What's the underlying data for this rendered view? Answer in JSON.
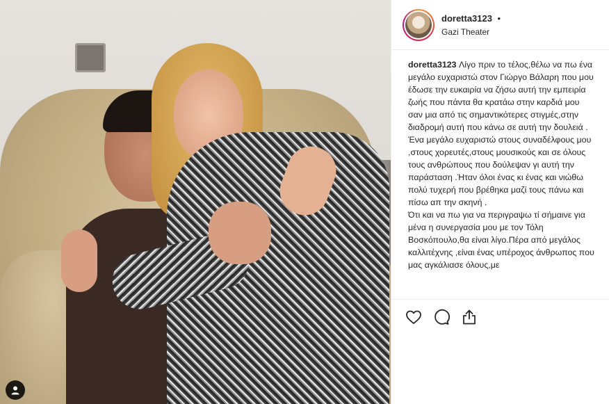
{
  "post": {
    "username": "doretta3123",
    "dot": "•",
    "location": "Gazi Theater"
  },
  "caption": {
    "username": "doretta3123",
    "text": " Λίγο πριν το τέλος,θέλω να πω ένα μεγάλο ευχαριστώ στον Γιώργο Βάλαρη που μου έδωσε την ευκαιρία να ζήσω αυτή την εμπειρία ζωής που πάντα θα κρατάω στην καρδιά μου σαν μια από τις σημαντικότερες στιγμές,στην διαδρομή αυτή που κάνω σε αυτή την δουλειά .\nΈνα μεγάλο ευχαριστώ στους συναδέλφους μου ,στους χορευτές,στους μουσικούς και σε όλους τους ανθρώπους που δούλεψαν γι αυτή την παράσταση .Ήταν όλοι ένας κι ένας και νιώθω πολύ τυχερή που βρέθηκα μαζί τους πάνω και πίσω απ την σκηνή .\nΌτι και να πω για να περιγραψω τί σήμαινε για μένα η συνεργασία μου με τον Τόλη Βοσκόπουλο,θα είναι λίγο.Πέρα από μεγάλος καλλιτέχνης ,είναι ένας υπέροχος άνθρωπος που μας αγκάλιασε όλους,με"
  },
  "icons": {
    "like": "heart-icon",
    "comment": "comment-icon",
    "share": "share-icon",
    "user_tag": "user-icon"
  }
}
